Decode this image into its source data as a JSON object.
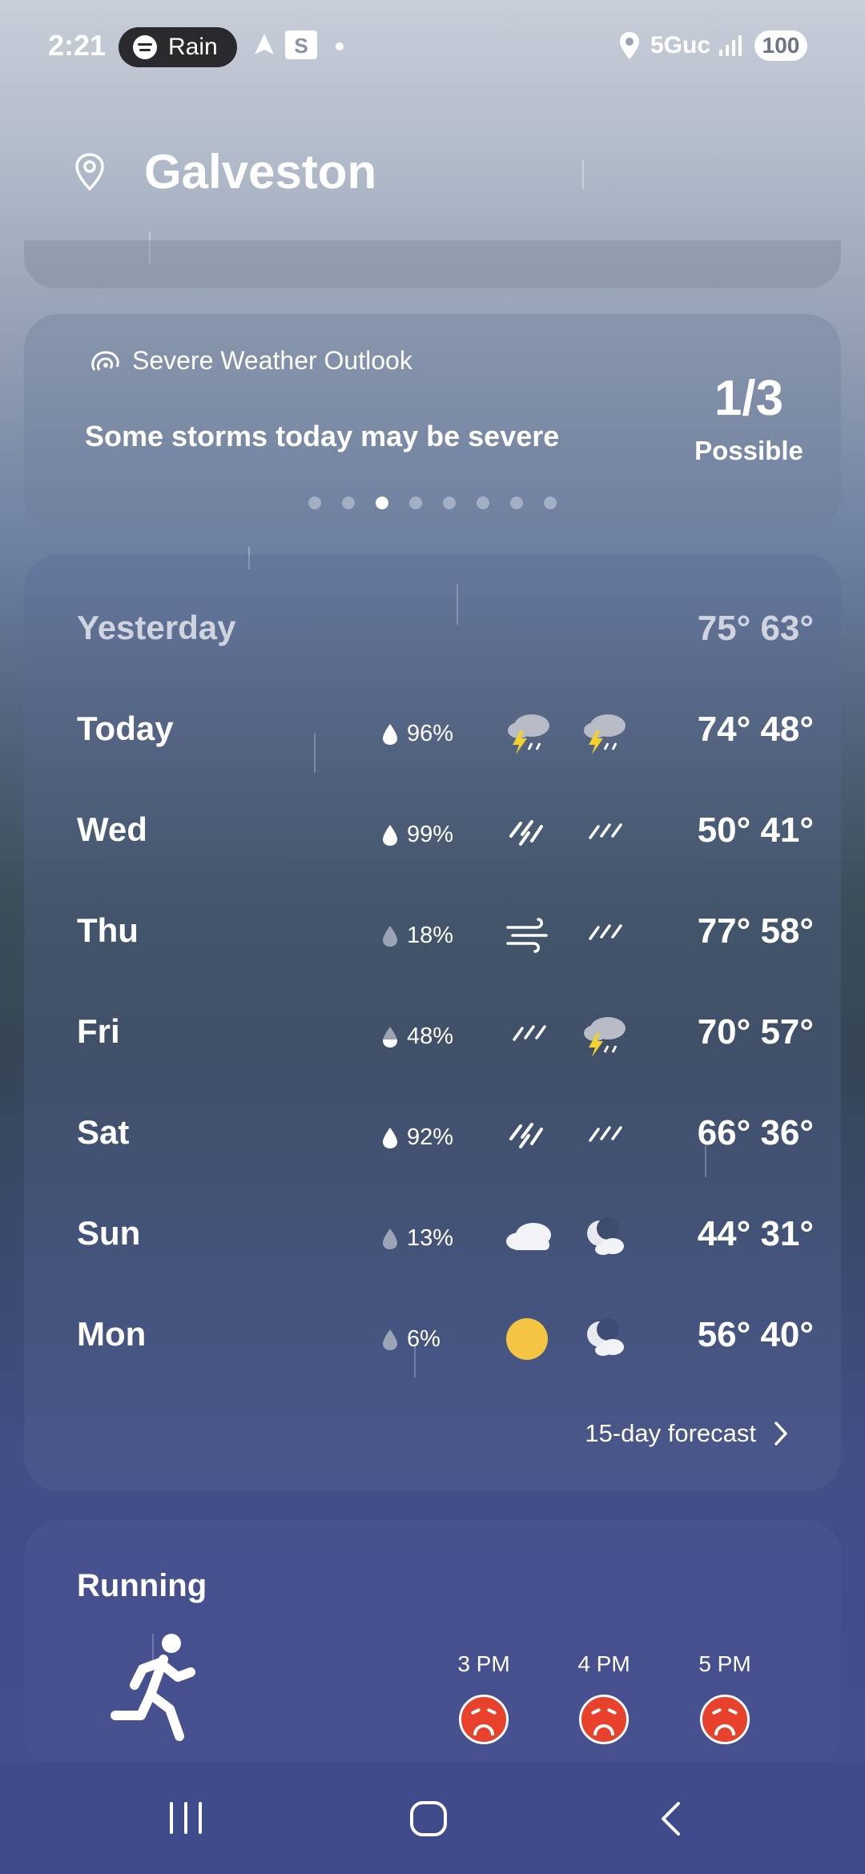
{
  "status_bar": {
    "time": "2:21",
    "media_pill": "Rain",
    "network": "5Guc",
    "battery": "100"
  },
  "header": {
    "city": "Galveston"
  },
  "severe": {
    "title": "Severe Weather Outlook",
    "text": "Some storms today may be severe",
    "value": "1/3",
    "label": "Possible",
    "page_dots": 8,
    "active_dot": 3
  },
  "forecast": {
    "rows": [
      {
        "day": "Yesterday",
        "precip": "",
        "icon_day": "",
        "icon_night": "",
        "temps": "75° 63°"
      },
      {
        "day": "Today",
        "precip": "96%",
        "icon_day": "thunderstorm-icon",
        "icon_night": "thunderstorm-icon",
        "temps": "74° 48°"
      },
      {
        "day": "Wed",
        "precip": "99%",
        "icon_day": "heavy-rain-icon",
        "icon_night": "rain-icon",
        "temps": "50° 41°"
      },
      {
        "day": "Thu",
        "precip": "18%",
        "icon_day": "wind-icon",
        "icon_night": "rain-icon",
        "temps": "77° 58°"
      },
      {
        "day": "Fri",
        "precip": "48%",
        "icon_day": "rain-icon",
        "icon_night": "thunderstorm-icon",
        "temps": "70° 57°"
      },
      {
        "day": "Sat",
        "precip": "92%",
        "icon_day": "heavy-rain-icon",
        "icon_night": "rain-icon",
        "temps": "66° 36°"
      },
      {
        "day": "Sun",
        "precip": "13%",
        "icon_day": "cloud-icon",
        "icon_night": "moon-cloud-icon",
        "temps": "44° 31°"
      },
      {
        "day": "Mon",
        "precip": "6%",
        "icon_day": "sun-icon",
        "icon_night": "moon-cloud-icon",
        "temps": "56° 40°"
      }
    ],
    "more_label": "15-day forecast"
  },
  "running": {
    "title": "Running",
    "hours": [
      "3 PM",
      "4 PM",
      "5 PM"
    ],
    "rating_icon": "frown-face-icon"
  },
  "colors": {
    "frown": "#e8412c",
    "lightning": "#f2d22e",
    "sun": "#f4c542"
  }
}
